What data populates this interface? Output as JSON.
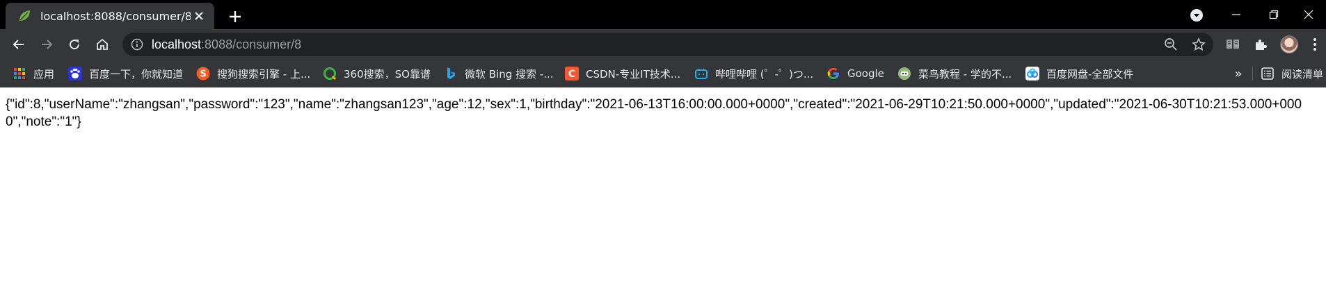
{
  "colors": {
    "tabstrip_bg": "#000000",
    "toolbar_bg": "#35363a",
    "omnibox_bg": "#202124",
    "text_light": "#e8eaed",
    "url_dim": "#9aa0a6"
  },
  "tab": {
    "title": "localhost:8088/consumer/8",
    "favicon": "spring-leaf-icon",
    "close_glyph": "✕"
  },
  "toolbar": {
    "url_host": "localhost",
    "url_rest": ":8088/consumer/8"
  },
  "bookmarks": {
    "items": [
      {
        "label": "应用",
        "icon": "apps-grid-icon"
      },
      {
        "label": "百度一下，你就知道",
        "icon": "baidu-paw-icon"
      },
      {
        "label": "搜狗搜索引擎 - 上...",
        "icon": "sogou-icon"
      },
      {
        "label": "360搜索，SO靠谱",
        "icon": "so360-icon"
      },
      {
        "label": "微软 Bing 搜索 -...",
        "icon": "bing-icon"
      },
      {
        "label": "CSDN-专业IT技术...",
        "icon": "csdn-icon"
      },
      {
        "label": "哔哩哔哩 (゜-゜)つ...",
        "icon": "bilibili-icon"
      },
      {
        "label": "Google",
        "icon": "google-icon"
      },
      {
        "label": "菜鸟教程 - 学的不...",
        "icon": "runoob-icon"
      },
      {
        "label": "百度网盘-全部文件",
        "icon": "baidu-netdisk-icon"
      }
    ],
    "overflow_glyph": "»",
    "reading_list_label": "阅读清单"
  },
  "page": {
    "json_text": "{\"id\":8,\"userName\":\"zhangsan\",\"password\":\"123\",\"name\":\"zhangsan123\",\"age\":12,\"sex\":1,\"birthday\":\"2021-06-13T16:00:00.000+0000\",\"created\":\"2021-06-29T10:21:50.000+0000\",\"updated\":\"2021-06-30T10:21:53.000+0000\",\"note\":\"1\"}"
  }
}
